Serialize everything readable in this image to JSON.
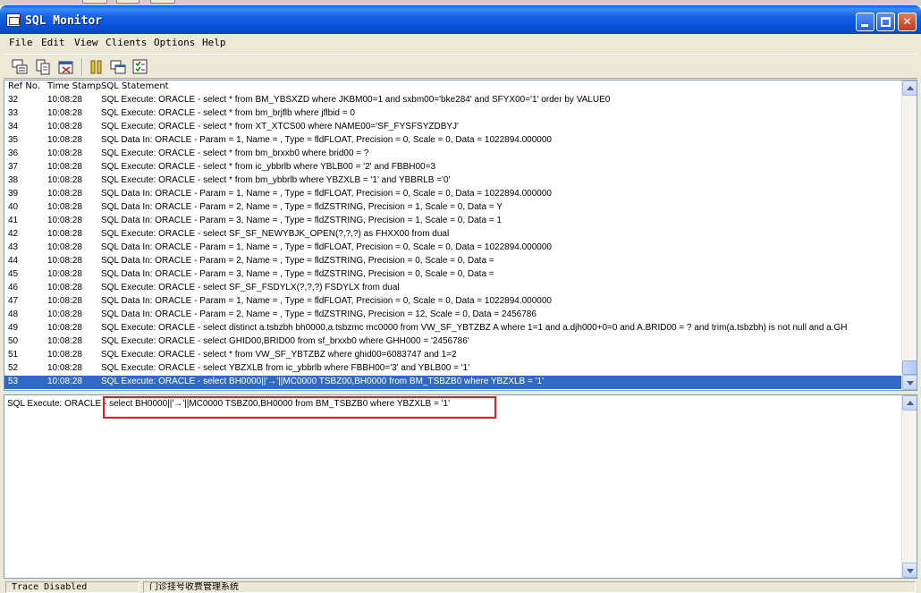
{
  "window": {
    "title": "SQL Monitor"
  },
  "menu": [
    "File",
    "Edit",
    "View",
    "Clients",
    "Options",
    "Help"
  ],
  "toolbar": [
    "save-log-icon",
    "copy-icon",
    "clear-icon",
    "pause-icon",
    "tile-icon",
    "options-icon"
  ],
  "list": {
    "headers": {
      "ref": "Ref No.",
      "time": "Time Stamp",
      "stmt": "SQL Statement"
    },
    "rows": [
      {
        "ref": "32",
        "time": "10:08:28",
        "stmt": "SQL Execute: ORACLE - select * from BM_YBSXZD where JKBM00=1 and sxbm00='bke284' and SFYX00='1' order by VALUE0"
      },
      {
        "ref": "33",
        "time": "10:08:28",
        "stmt": "SQL Execute: ORACLE - select * from bm_brjflb where jflbid = 0"
      },
      {
        "ref": "34",
        "time": "10:08:28",
        "stmt": "SQL Execute: ORACLE - select * from XT_XTCS00 where NAME00='SF_FYSFSYZDBYJ'"
      },
      {
        "ref": "35",
        "time": "10:08:28",
        "stmt": "SQL Data In: ORACLE - Param = 1, Name = , Type = fldFLOAT, Precision = 0, Scale = 0, Data = 1022894.000000"
      },
      {
        "ref": "36",
        "time": "10:08:28",
        "stmt": "SQL Execute: ORACLE - select * from bm_brxxb0 where brid00 = ?"
      },
      {
        "ref": "37",
        "time": "10:08:28",
        "stmt": "SQL Execute: ORACLE - select * from ic_ybbrlb where YBLB00 = '2' and FBBH00=3"
      },
      {
        "ref": "38",
        "time": "10:08:28",
        "stmt": "SQL Execute: ORACLE - select * from bm_ybbrlb where YBZXLB = '1' and YBBRLB ='0'"
      },
      {
        "ref": "39",
        "time": "10:08:28",
        "stmt": "SQL Data In: ORACLE - Param = 1, Name = , Type = fldFLOAT, Precision = 0, Scale = 0, Data = 1022894.000000"
      },
      {
        "ref": "40",
        "time": "10:08:28",
        "stmt": "SQL Data In: ORACLE - Param = 2, Name = , Type = fldZSTRING, Precision = 1, Scale = 0, Data = Y"
      },
      {
        "ref": "41",
        "time": "10:08:28",
        "stmt": "SQL Data In: ORACLE - Param = 3, Name = , Type = fldZSTRING, Precision = 1, Scale = 0, Data = 1"
      },
      {
        "ref": "42",
        "time": "10:08:28",
        "stmt": "SQL Execute: ORACLE - select SF_SF_NEWYBJK_OPEN(?,?,?) as FHXX00 from dual"
      },
      {
        "ref": "43",
        "time": "10:08:28",
        "stmt": "SQL Data In: ORACLE - Param = 1, Name = , Type = fldFLOAT, Precision = 0, Scale = 0, Data = 1022894.000000"
      },
      {
        "ref": "44",
        "time": "10:08:28",
        "stmt": "SQL Data In: ORACLE - Param = 2, Name = , Type = fldZSTRING, Precision = 0, Scale = 0, Data ="
      },
      {
        "ref": "45",
        "time": "10:08:28",
        "stmt": "SQL Data In: ORACLE - Param = 3, Name = , Type = fldZSTRING, Precision = 0, Scale = 0, Data ="
      },
      {
        "ref": "46",
        "time": "10:08:28",
        "stmt": "SQL Execute: ORACLE - select SF_SF_FSDYLX(?,?,?) FSDYLX from dual"
      },
      {
        "ref": "47",
        "time": "10:08:28",
        "stmt": "SQL Data In: ORACLE - Param = 1, Name = , Type = fldFLOAT, Precision = 0, Scale = 0, Data = 1022894.000000"
      },
      {
        "ref": "48",
        "time": "10:08:28",
        "stmt": "SQL Data In: ORACLE - Param = 2, Name = , Type = fldZSTRING, Precision = 12, Scale = 0, Data = 2456786"
      },
      {
        "ref": "49",
        "time": "10:08:28",
        "stmt": "SQL Execute: ORACLE - select distinct a.tsbzbh bh0000,a.tsbzmc mc0000 from VW_SF_YBTZBZ A where 1=1 and a.djh000+0=0 and A.BRID00 = ? and trim(a.tsbzbh) is not null and a.GH"
      },
      {
        "ref": "50",
        "time": "10:08:28",
        "stmt": "SQL Execute: ORACLE - select GHID00,BRID00 from sf_brxxb0 where GHH000 = '2456786'"
      },
      {
        "ref": "51",
        "time": "10:08:28",
        "stmt": "SQL Execute: ORACLE - select * from VW_SF_YBTZBZ where ghid00=6083747 and 1=2"
      },
      {
        "ref": "52",
        "time": "10:08:28",
        "stmt": "SQL Execute: ORACLE - select YBZXLB from ic_ybbrlb where FBBH00='3' and YBLB00 = '1'"
      },
      {
        "ref": "53",
        "time": "10:08:28",
        "stmt": "SQL Execute: ORACLE - select BH0000||'→'||MC0000 TSBZ00,BH0000 from BM_TSBZB0 where YBZXLB = '1'"
      }
    ],
    "selected_ref": "53"
  },
  "detail": {
    "text": "SQL Execute: ORACLE - select BH0000||'→'||MC0000 TSBZ00,BH0000 from BM_TSBZB0 where YBZXLB = '1'"
  },
  "status": {
    "trace": "Trace Disabled",
    "app": "门诊挂号收费管理系统"
  },
  "colors": {
    "selection": "#316AC5",
    "highlight_box": "#E02020",
    "titlebar": "#0A48C8"
  }
}
